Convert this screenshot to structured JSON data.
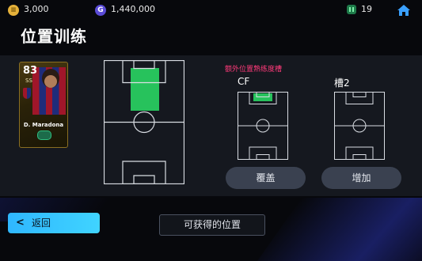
{
  "currency": {
    "coins": "3,000",
    "gp": "1,440,000",
    "stamina": "19",
    "coin_icon": "coin-icon",
    "gp_icon_glyph": "G",
    "gp_icon": "gp-icon",
    "stamina_icon": "stamina-icon",
    "home_icon": "home-icon"
  },
  "page": {
    "title": "位置训练"
  },
  "player_card": {
    "rating": "83",
    "rarity": "SS",
    "name": "D. Maradona"
  },
  "extra_positions": {
    "title": "额外位置熟练度槽",
    "current_label": "CF",
    "slot_label": "槽2",
    "override_button": "覆盖",
    "add_button": "增加"
  },
  "footer": {
    "back_button": "返回",
    "available_positions_button": "可获得的位置"
  },
  "colors": {
    "accent_green": "#27c25c",
    "accent_pink": "#ff3a7a",
    "back_button": "#2fb7ff"
  }
}
